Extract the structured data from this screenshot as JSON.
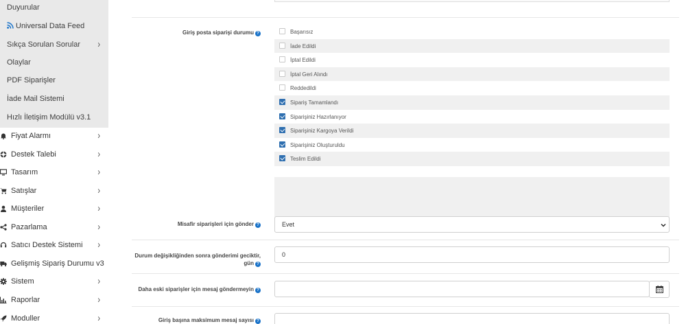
{
  "sidebar": {
    "sub_items": [
      {
        "label": "Duyurular",
        "icon": "",
        "has_chevron": false
      },
      {
        "label": "Universal Data Feed",
        "icon": "rss-icon",
        "has_chevron": false
      },
      {
        "label": "Sıkça Sorulan Sorular",
        "icon": "",
        "has_chevron": true
      },
      {
        "label": "Olaylar",
        "icon": "",
        "has_chevron": false
      },
      {
        "label": "PDF Siparişler",
        "icon": "",
        "has_chevron": false
      },
      {
        "label": "İade Mail Sistemi",
        "icon": "",
        "has_chevron": false
      },
      {
        "label": "Hızlı İletişim Modülü v3.1",
        "icon": "",
        "has_chevron": false
      }
    ],
    "main_items": [
      {
        "label": "Fiyat Alarmı",
        "icon": "bell-icon",
        "has_chevron": true
      },
      {
        "label": "Destek Talebi",
        "icon": "lifebuoy-icon",
        "has_chevron": true
      },
      {
        "label": "Tasarım",
        "icon": "monitor-icon",
        "has_chevron": true
      },
      {
        "label": "Satışlar",
        "icon": "cart-icon",
        "has_chevron": true
      },
      {
        "label": "Müşteriler",
        "icon": "user-icon",
        "has_chevron": true
      },
      {
        "label": "Pazarlama",
        "icon": "share-icon",
        "has_chevron": true
      },
      {
        "label": "Satıcı Destek Sistemi",
        "icon": "support-icon",
        "has_chevron": true
      },
      {
        "label": "Gelişmiş Sipariş Durumu v3",
        "icon": "truck-icon",
        "has_chevron": false
      },
      {
        "label": "Sistem",
        "icon": "gear-icon",
        "has_chevron": true
      },
      {
        "label": "Raporlar",
        "icon": "bar-chart-icon",
        "has_chevron": true
      },
      {
        "label": "Moduller",
        "icon": "rocket-icon",
        "has_chevron": true
      }
    ],
    "chevron": "›"
  },
  "form": {
    "status_label": "Giriş posta siparişi durumu",
    "statuses": [
      {
        "label": "Başarısız",
        "checked": false
      },
      {
        "label": "İade Edildi",
        "checked": false
      },
      {
        "label": "İptal Edildi",
        "checked": false
      },
      {
        "label": "İptal Geri Alındı",
        "checked": false
      },
      {
        "label": "Reddedildi",
        "checked": false
      },
      {
        "label": "Sipariş Tamamlandı",
        "checked": true
      },
      {
        "label": "Siparişiniz Hazırlanıyor",
        "checked": true
      },
      {
        "label": "Siparişiniz Kargoya Verildi",
        "checked": true
      },
      {
        "label": "Siparişiniz Oluşturuldu",
        "checked": true
      },
      {
        "label": "Teslim Edildi",
        "checked": true
      }
    ],
    "guest_label": "Misafir siparişleri için gönder",
    "guest_value": "Evet",
    "delay_label_line1": "Durum değişikliğinden sonra gönderimi geciktir,",
    "delay_label_line2": "gün",
    "delay_value": "0",
    "old_orders_label": "Daha eski siparişler için mesaj göndermeyin",
    "old_orders_value": "",
    "max_label": "Giriş başına maksimum mesaj sayısı",
    "max_value": ""
  },
  "colors": {
    "accent": "#2f6fb0",
    "help_icon": "#1a73c9",
    "submenu_bg": "#e9e9e9",
    "rss": "#1a73c9"
  }
}
